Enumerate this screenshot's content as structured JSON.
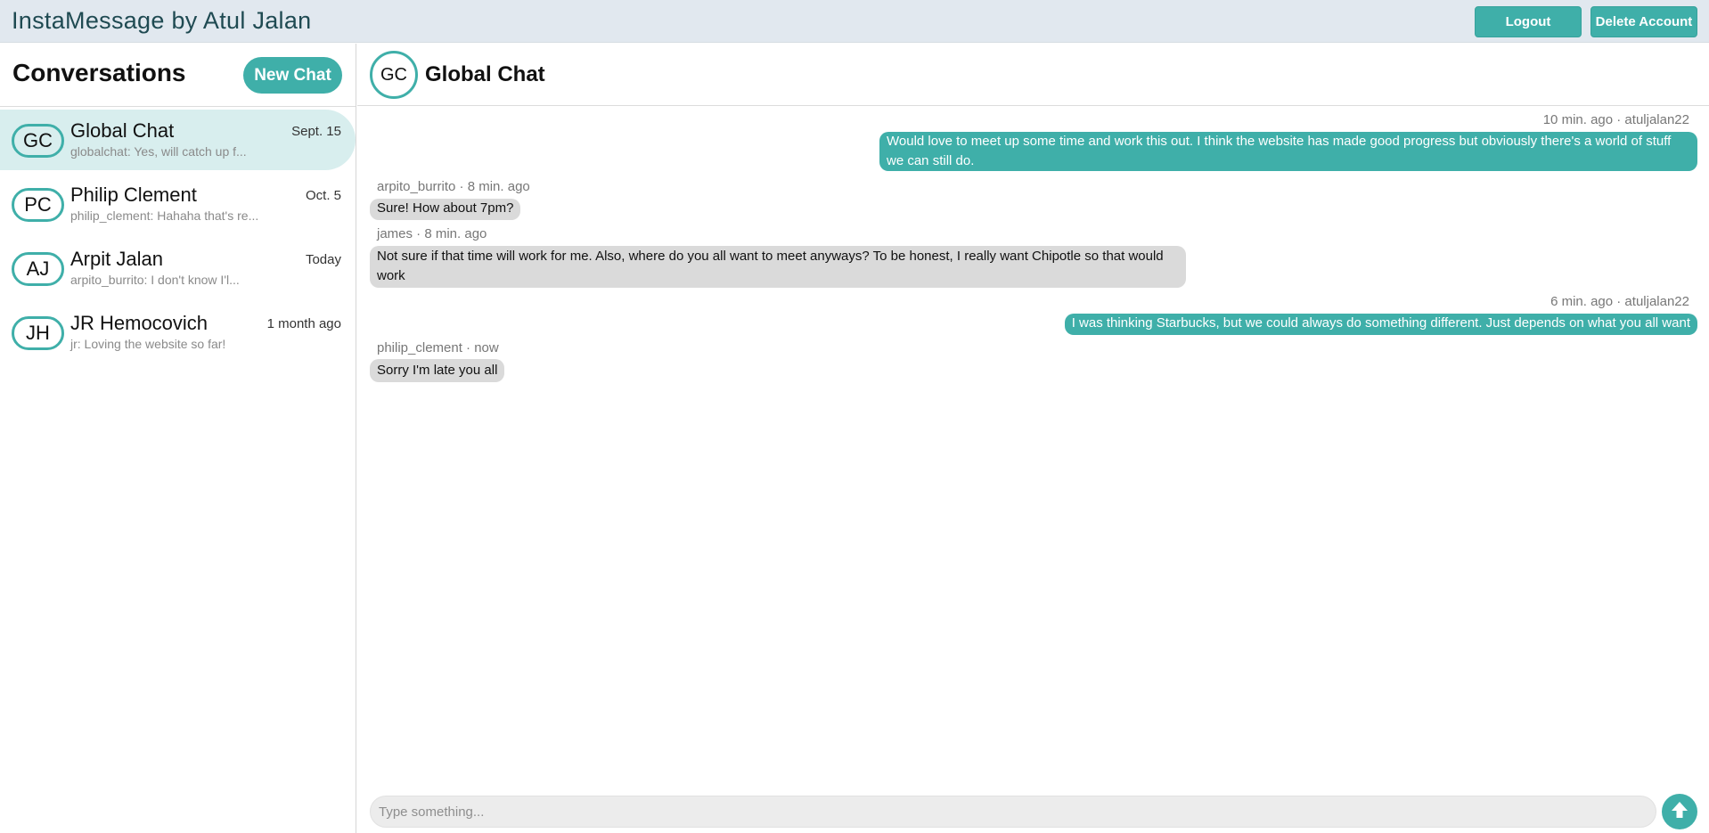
{
  "app": {
    "title": "InstaMessage by Atul Jalan",
    "logout_label": "Logout",
    "delete_label": "Delete Account"
  },
  "sidebar": {
    "title": "Conversations",
    "new_chat_label": "New Chat",
    "conversations": [
      {
        "initials": "GC",
        "name": "Global Chat",
        "preview": "globalchat: Yes, will catch up f...",
        "date": "Sept. 15",
        "active": true
      },
      {
        "initials": "PC",
        "name": "Philip Clement",
        "preview": "philip_clement: Hahaha that's re...",
        "date": "Oct. 5",
        "active": false
      },
      {
        "initials": "AJ",
        "name": "Arpit Jalan",
        "preview": "arpito_burrito: I don't know I'l...",
        "date": "Today",
        "active": false
      },
      {
        "initials": "JH",
        "name": "JR Hemocovich",
        "preview": "jr: Loving the website so far!",
        "date": "1 month ago",
        "active": false
      }
    ]
  },
  "chat": {
    "initials": "GC",
    "title": "Global Chat",
    "messages": [
      {
        "meta": "10 min. ago · atuljalan22",
        "text": "Would love to meet up some time and work this out. I think the website has made good progress but obviously there's a world of stuff we can still do.",
        "mine": true
      },
      {
        "meta": "arpito_burrito · 8 min. ago",
        "text": "Sure! How about 7pm?",
        "mine": false
      },
      {
        "meta": "james · 8 min. ago",
        "text": "Not sure if that time will work for me. Also, where do you all want to meet anyways? To be honest, I really want Chipotle so that would work",
        "mine": false
      },
      {
        "meta": "6 min. ago · atuljalan22",
        "text": "I was thinking Starbucks, but we could always do something different. Just depends on what you all want",
        "mine": true
      },
      {
        "meta": "philip_clement · now",
        "text": "Sorry I'm late you all",
        "mine": false
      }
    ],
    "composer": {
      "placeholder": "Type something...",
      "value": ""
    },
    "send_icon": "arrow-up-icon"
  },
  "colors": {
    "accent": "#3fafa9",
    "topbar": "#e1e8ef",
    "active_conversation": "#d8eeee",
    "incoming_bubble": "#dadada"
  }
}
